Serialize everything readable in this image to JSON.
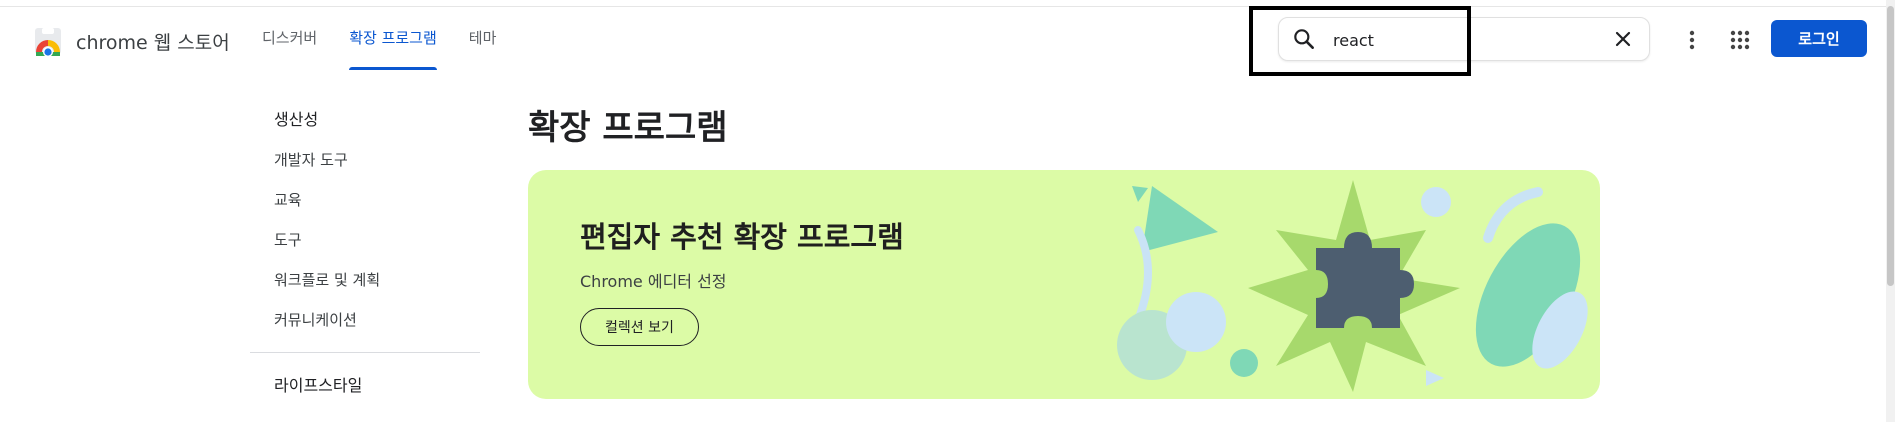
{
  "header": {
    "brand": "chrome 웹 스토어",
    "logo_icon": "chrome-web-store-logo",
    "nav": [
      {
        "label": "디스커버",
        "active": false
      },
      {
        "label": "확장 프로그램",
        "active": true
      },
      {
        "label": "테마",
        "active": false
      }
    ],
    "search": {
      "value": "react",
      "icon": "search-icon",
      "clear_icon": "close-icon"
    },
    "more_icon": "more-vert-icon",
    "apps_icon": "apps-grid-icon",
    "login_label": "로그인",
    "accent": "#0b57d0"
  },
  "sidebar": {
    "items": [
      "생산성",
      "개발자 도구",
      "교육",
      "도구",
      "워크플로 및 계획",
      "커뮤니케이션"
    ],
    "section2": "라이프스타일"
  },
  "main": {
    "title": "확장 프로그램",
    "banner": {
      "title": "편집자 추천 확장 프로그램",
      "subtitle": "Chrome 에디터 선정",
      "button_label": "컬렉션 보기",
      "background": "#dcfba6",
      "art_icon": "puzzle-piece-icon"
    }
  }
}
